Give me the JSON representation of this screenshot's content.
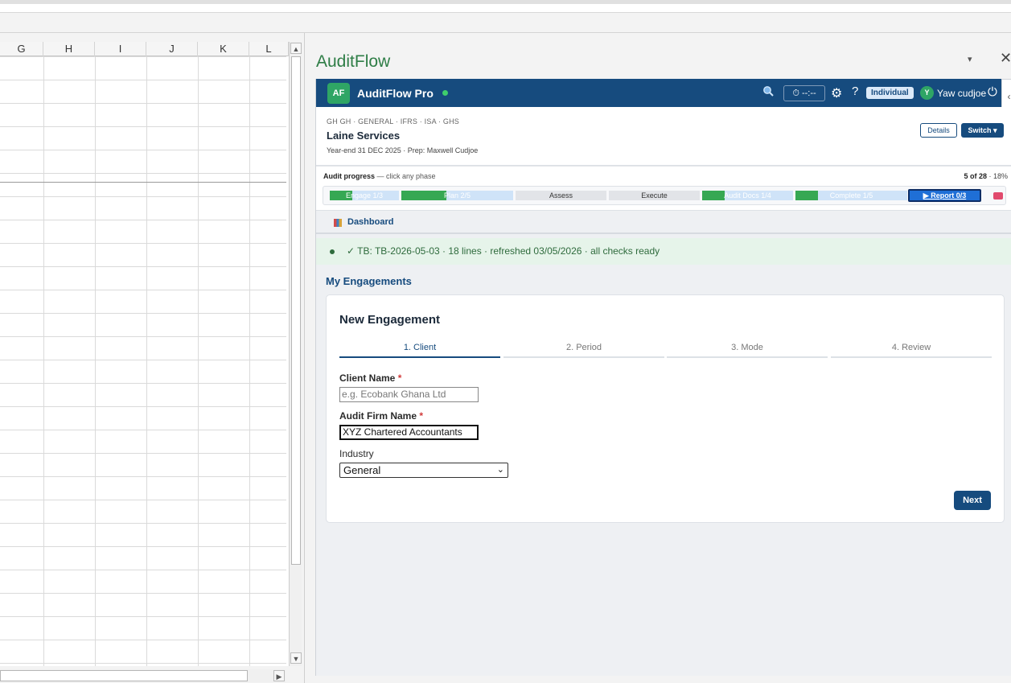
{
  "spreadsheet": {
    "columns": [
      "G",
      "H",
      "I",
      "J",
      "K",
      "L"
    ]
  },
  "pane": {
    "title": "AuditFlow",
    "dropdown_glyph": "▾",
    "close_glyph": "✕"
  },
  "header": {
    "logo": "AF",
    "app_name": "AuditFlow Pro",
    "timer": "⏱ --:--",
    "role": "Individual",
    "avatar_initial": "Y",
    "user_name": "Yaw cudjoe",
    "collapse_glyph": "‹"
  },
  "client": {
    "tags": "GH GH · GENERAL · IFRS · ISA · GHS",
    "name": "Laine Services",
    "meta": "Year-end 31 DEC 2025 · Prep: Maxwell Cudjoe",
    "details_label": "Details",
    "switch_label": "Switch ▾"
  },
  "progress": {
    "title": "Audit progress",
    "hint": "— click any phase",
    "count": "5 of 28",
    "percent": "· 18%",
    "phases": [
      {
        "label": "Engage 1/3",
        "fraction": 0.33
      },
      {
        "label": "Plan 2/5",
        "fraction": 0.4
      },
      {
        "label": "Assess",
        "fraction": 0
      },
      {
        "label": "Execute",
        "fraction": 0
      },
      {
        "label": "Audit Docs 1/4",
        "fraction": 0.25
      },
      {
        "label": "Complete 1/5",
        "fraction": 0.2
      },
      {
        "label": "▶ Report 0/3",
        "fraction": 0
      }
    ]
  },
  "tabs": {
    "dashboard": "Dashboard"
  },
  "status": {
    "text": "✓ TB: TB-2026-05-03 · 18 lines · refreshed 03/05/2026 · all checks ready"
  },
  "section_title": "My Engagements",
  "form": {
    "title": "New Engagement",
    "steps": [
      "1. Client",
      "2. Period",
      "3. Mode",
      "4. Review"
    ],
    "client_name_label": "Client Name",
    "client_name_placeholder": "e.g. Ecobank Ghana Ltd",
    "firm_label": "Audit Firm Name",
    "firm_value": "XYZ Chartered Accountants",
    "industry_label": "Industry",
    "industry_value": "General",
    "required_mark": "*",
    "next_label": "Next"
  },
  "colors": {
    "brand_navy": "#164b7e",
    "success_green": "#36a853",
    "title_green": "#2e7d46"
  }
}
